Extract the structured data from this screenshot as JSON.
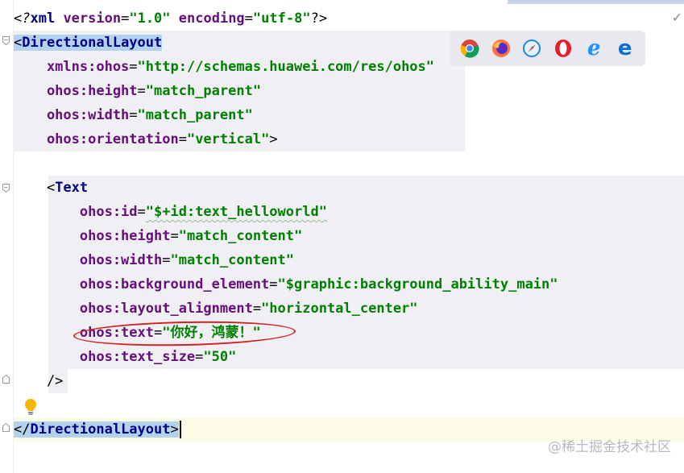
{
  "editor": {
    "lines": [
      {
        "parts": [
          [
            "punc",
            "<?"
          ],
          [
            "tag",
            "xml "
          ],
          [
            "attr",
            "version"
          ],
          [
            "punc",
            "="
          ],
          [
            "val",
            "\"1.0\""
          ],
          [
            "punc",
            " "
          ],
          [
            "attr",
            "encoding"
          ],
          [
            "punc",
            "="
          ],
          [
            "val",
            "\"utf-8\""
          ],
          [
            "punc",
            "?>"
          ]
        ]
      },
      {
        "parts": [
          [
            "punc",
            "<"
          ],
          [
            "tag",
            "DirectionalLayout"
          ]
        ]
      },
      {
        "parts": [
          [
            "attr",
            "    xmlns:ohos"
          ],
          [
            "punc",
            "="
          ],
          [
            "val",
            "\"http://schemas.huawei.com/res/ohos\""
          ]
        ]
      },
      {
        "parts": [
          [
            "attr",
            "    ohos:height"
          ],
          [
            "punc",
            "="
          ],
          [
            "val",
            "\"match_parent\""
          ]
        ]
      },
      {
        "parts": [
          [
            "attr",
            "    ohos:width"
          ],
          [
            "punc",
            "="
          ],
          [
            "val",
            "\"match_parent\""
          ]
        ]
      },
      {
        "parts": [
          [
            "attr",
            "    ohos:orientation"
          ],
          [
            "punc",
            "="
          ],
          [
            "val",
            "\"vertical\""
          ],
          [
            "punc",
            ">"
          ]
        ]
      },
      {
        "parts": []
      },
      {
        "parts": [
          [
            "punc",
            "    <"
          ],
          [
            "tag",
            "Text"
          ]
        ]
      },
      {
        "parts": [
          [
            "attr",
            "        ohos:id"
          ],
          [
            "punc",
            "="
          ],
          [
            "val",
            "\"$+id:text_helloworld\""
          ]
        ]
      },
      {
        "parts": [
          [
            "attr",
            "        ohos:height"
          ],
          [
            "punc",
            "="
          ],
          [
            "val",
            "\"match_content\""
          ]
        ]
      },
      {
        "parts": [
          [
            "attr",
            "        ohos:width"
          ],
          [
            "punc",
            "="
          ],
          [
            "val",
            "\"match_content\""
          ]
        ]
      },
      {
        "parts": [
          [
            "attr",
            "        ohos:background_element"
          ],
          [
            "punc",
            "="
          ],
          [
            "val",
            "\"$graphic:background_ability_main\""
          ]
        ]
      },
      {
        "parts": [
          [
            "attr",
            "        ohos:layout_alignment"
          ],
          [
            "punc",
            "="
          ],
          [
            "val",
            "\"horizontal_center\""
          ]
        ]
      },
      {
        "parts": [
          [
            "attr",
            "        ohos:text"
          ],
          [
            "punc",
            "="
          ],
          [
            "val",
            "\"你好，鸿蒙！\""
          ]
        ]
      },
      {
        "parts": [
          [
            "attr",
            "        ohos:text_size"
          ],
          [
            "punc",
            "="
          ],
          [
            "val",
            "\"50\""
          ]
        ]
      },
      {
        "parts": [
          [
            "punc",
            "    />"
          ]
        ]
      },
      {
        "parts": []
      },
      {
        "parts": [
          [
            "punc",
            "</"
          ],
          [
            "tag",
            "DirectionalLayout"
          ],
          [
            "punc",
            ">"
          ]
        ]
      }
    ]
  },
  "browsers": [
    "chrome-icon",
    "firefox-icon",
    "safari-icon",
    "opera-icon",
    "ie-icon",
    "edge-icon"
  ],
  "watermark": "@稀土掘金技术社区",
  "checkmark": "✓"
}
